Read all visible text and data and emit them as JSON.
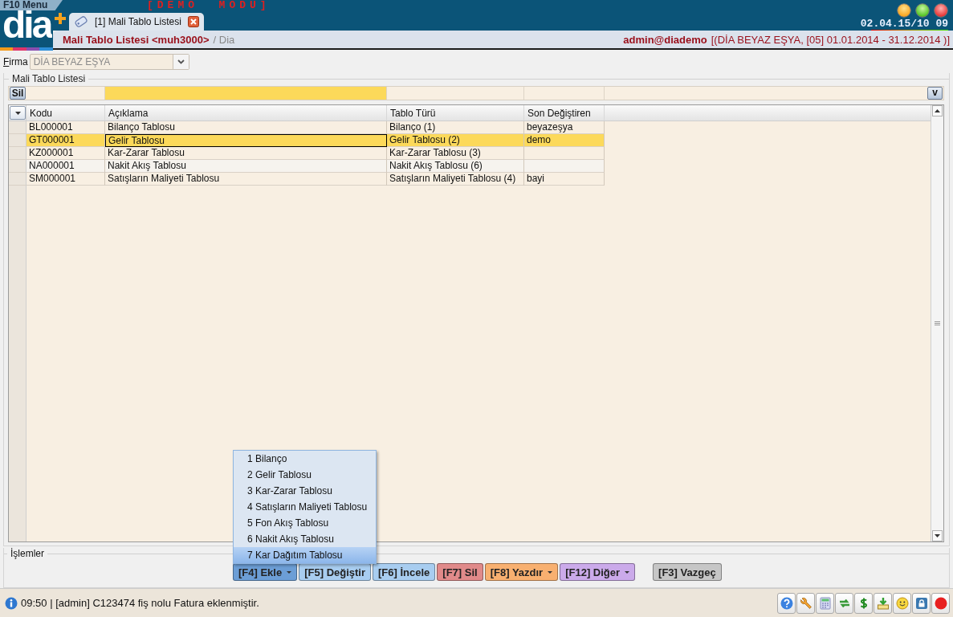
{
  "menu_bar": {
    "menu_label": "F10 Menu",
    "mode_banner": "[DEMO MODU]"
  },
  "logo": "dia",
  "tabs": [
    {
      "label": "[1] Mali Tablo Listesi",
      "selected": true
    }
  ],
  "clock": "02.04.15/10 09",
  "breadcrumb": {
    "title": "Mali Tablo Listesi <muh3000>",
    "path": "/ Dia"
  },
  "session": {
    "user": "admin@diademo",
    "context": "[(DİA BEYAZ EŞYA, [05] 01.01.2014 - 31.12.2014 )]"
  },
  "firma": {
    "label": "Firma",
    "value": "DİA BEYAZ EŞYA"
  },
  "list_group": {
    "title": "Mali Tablo Listesi",
    "filter_button": "Sil",
    "column_chooser": "v",
    "columns": [
      {
        "label": "Kodu",
        "filter_active": false
      },
      {
        "label": "Açıklama",
        "filter_active": true
      },
      {
        "label": "Tablo Türü",
        "filter_active": false
      },
      {
        "label": "Son Değiştiren",
        "filter_active": false
      }
    ],
    "rows": [
      {
        "cells": [
          "BL000001",
          "Bilanço Tablosu",
          "Bilanço (1)",
          "beyazeşya"
        ],
        "selected": false
      },
      {
        "cells": [
          "GT000001",
          "Gelir Tablosu",
          "Gelir Tablosu (2)",
          "demo"
        ],
        "selected": true
      },
      {
        "cells": [
          "KZ000001",
          "Kar-Zarar Tablosu",
          "Kar-Zarar Tablosu (3)",
          ""
        ],
        "selected": false
      },
      {
        "cells": [
          "NA000001",
          "Nakit Akış Tablosu",
          "Nakit Akış Tablosu (6)",
          ""
        ],
        "selected": false
      },
      {
        "cells": [
          "SM000001",
          "Satışların Maliyeti Tablosu",
          "Satışların Maliyeti Tablosu (4)",
          "bayi"
        ],
        "selected": false
      }
    ]
  },
  "add_menu": {
    "items": [
      {
        "label": "1 Bilanço",
        "selected": false
      },
      {
        "label": "2 Gelir Tablosu",
        "selected": false
      },
      {
        "label": "3 Kar-Zarar Tablosu",
        "selected": false
      },
      {
        "label": "4 Satışların Maliyeti Tablosu",
        "selected": false
      },
      {
        "label": "5 Fon Akış Tablosu",
        "selected": false
      },
      {
        "label": "6 Nakit Akış Tablosu",
        "selected": false
      },
      {
        "label": "7 Kar Dağıtım Tablosu",
        "selected": true
      }
    ]
  },
  "actions": {
    "title": "İşlemler",
    "buttons": [
      {
        "label": "[F4] Ekle",
        "color": "#6c9ed6",
        "kind": "menu"
      },
      {
        "label": "[F5] Değiştir",
        "color": "#a8cdf0",
        "kind": "plain"
      },
      {
        "label": "[F6] İncele",
        "color": "#a8cdf0",
        "kind": "plain"
      },
      {
        "label": "[F7] Sil",
        "color": "#e08a8a",
        "kind": "plain"
      },
      {
        "label": "[F8] Yazdır",
        "color": "#f8b070",
        "kind": "menu"
      },
      {
        "label": "[F12] Diğer",
        "color": "#cbaaea",
        "kind": "menu"
      },
      {
        "label": "[F3] Vazgeç",
        "color": "#c6c6c6",
        "kind": "separated"
      }
    ]
  },
  "status": {
    "message": "09:50 | [admin] C123474 fiş nolu Fatura eklenmiştir."
  }
}
